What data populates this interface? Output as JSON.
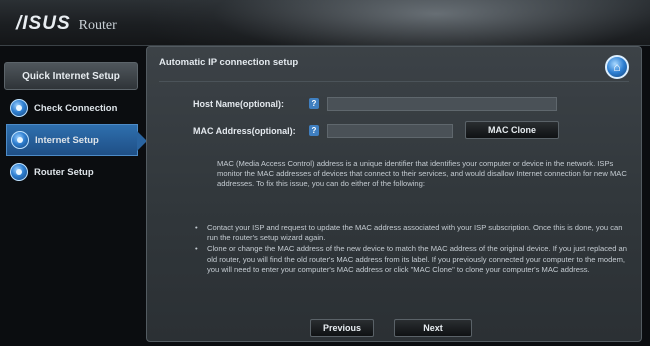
{
  "header": {
    "brand": "/ISUS",
    "product": "Router"
  },
  "sidebar": {
    "title": "Quick Internet Setup",
    "items": [
      {
        "label": "Check Connection",
        "icon": "step-circle-icon",
        "active": false
      },
      {
        "label": "Internet Setup",
        "icon": "step-circle-icon",
        "active": true
      },
      {
        "label": "Router Setup",
        "icon": "step-circle-icon",
        "active": false
      }
    ]
  },
  "main": {
    "title": "Automatic IP connection setup",
    "home_icon": "home-icon",
    "home_glyph": "⌂",
    "fields": {
      "host_name": {
        "label": "Host Name(optional):",
        "help": "?",
        "value": ""
      },
      "mac_address": {
        "label": "MAC Address(optional):",
        "help": "?",
        "value": ""
      }
    },
    "mac_clone_label": "MAC Clone",
    "description": "MAC (Media Access Control) address is a unique identifier that identifies your computer or device in the network. ISPs monitor the MAC addresses of devices that connect to their services, and would disallow Internet connection for new MAC addresses. To fix this issue, you can do either of the following:",
    "bullets": [
      "Contact your ISP and request to update the MAC address associated with your ISP subscription. Once this is done, you can run the router's setup wizard again.",
      "Clone or change the MAC address of the new device to match the MAC address of the original device. If you just replaced an old router, you will find the old router's MAC address from its label. If you previously connected your computer to the modem, you will need to enter your computer's MAC address or click \"MAC Clone\" to clone your computer's MAC address."
    ],
    "previous_label": "Previous",
    "next_label": "Next"
  },
  "colors": {
    "accent": "#2e6fae",
    "panel": "#3c4247",
    "background": "#0b0d10"
  }
}
